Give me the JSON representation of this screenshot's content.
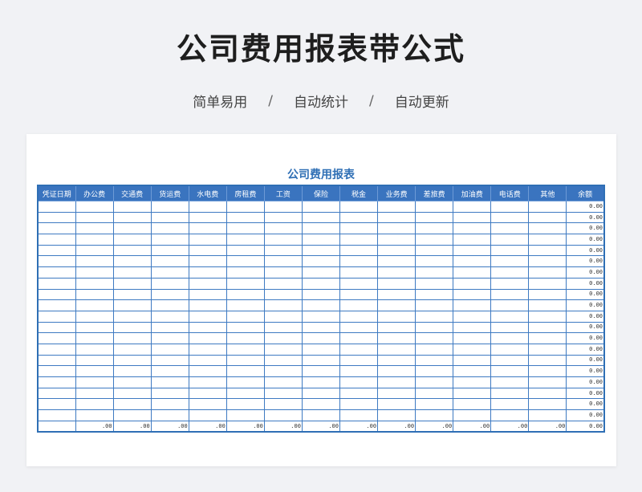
{
  "page": {
    "title": "公司费用报表带公式",
    "subtitle": [
      "简单易用",
      "自动统计",
      "自动更新"
    ],
    "separator": "/"
  },
  "report": {
    "title": "公司费用报表",
    "columns": [
      "凭证日期",
      "办公费",
      "交通费",
      "货运费",
      "水电费",
      "房租费",
      "工资",
      "保险",
      "税金",
      "业务费",
      "差旅费",
      "加油费",
      "电话费",
      "其他",
      "余额"
    ],
    "body_row_count": 20,
    "balance_value": "0.00",
    "total_value": ".00"
  }
}
